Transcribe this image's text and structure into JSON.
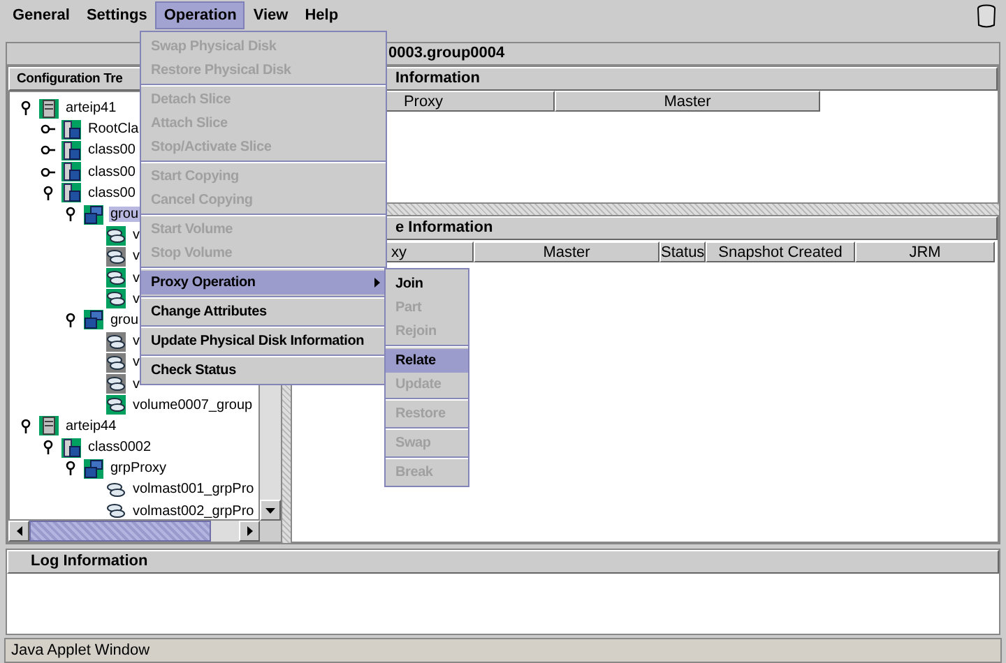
{
  "menubar": [
    {
      "label": "General",
      "selected": false
    },
    {
      "label": "Settings",
      "selected": false
    },
    {
      "label": "Operation",
      "selected": true
    },
    {
      "label": "View",
      "selected": false
    },
    {
      "label": "Help",
      "selected": false
    }
  ],
  "title_bar": "0003.group0004",
  "tree_panel": {
    "title": "Configuration Tre"
  },
  "tree": [
    {
      "label": "arteip41",
      "kind": "host",
      "expanded": true,
      "selected": false,
      "children": [
        {
          "label": "RootCla",
          "kind": "class",
          "expanded": false,
          "selected": false
        },
        {
          "label": "class00",
          "kind": "class",
          "expanded": false,
          "selected": false
        },
        {
          "label": "class00",
          "kind": "class",
          "expanded": false,
          "selected": false
        },
        {
          "label": "class00",
          "kind": "class",
          "expanded": true,
          "selected": false,
          "children": [
            {
              "label": "grou",
              "kind": "group",
              "expanded": true,
              "selected": true,
              "children": [
                {
                  "label": "v",
                  "kind": "volume",
                  "color": "#00a060",
                  "selected": false
                },
                {
                  "label": "v",
                  "kind": "volume",
                  "color": "#808080",
                  "selected": false
                },
                {
                  "label": "v",
                  "kind": "volume",
                  "color": "#00a060",
                  "selected": false
                },
                {
                  "label": "v",
                  "kind": "volume",
                  "color": "#00a060",
                  "selected": false
                }
              ]
            },
            {
              "label": "grou",
              "kind": "group",
              "expanded": true,
              "selected": false,
              "children": [
                {
                  "label": "v",
                  "kind": "volume",
                  "color": "#808080",
                  "selected": false
                },
                {
                  "label": "v",
                  "kind": "volume",
                  "color": "#808080",
                  "selected": false
                },
                {
                  "label": "v",
                  "kind": "volume",
                  "color": "#808080",
                  "selected": false
                },
                {
                  "label": "volume0007_group",
                  "kind": "volume",
                  "color": "#00a060",
                  "selected": false
                }
              ]
            }
          ]
        }
      ]
    },
    {
      "label": "arteip44",
      "kind": "host",
      "expanded": true,
      "selected": false,
      "children": [
        {
          "label": "class0002",
          "kind": "class",
          "expanded": true,
          "selected": false,
          "children": [
            {
              "label": "grpProxy",
              "kind": "group",
              "expanded": true,
              "selected": false,
              "children": [
                {
                  "label": "volmast001_grpPro",
                  "kind": "volume",
                  "selected": false
                },
                {
                  "label": "volmast002_grpPro",
                  "kind": "volume",
                  "selected": false
                }
              ]
            }
          ]
        }
      ]
    }
  ],
  "proxy_panel": {
    "title": "Information",
    "columns": [
      "Proxy",
      "Master"
    ]
  },
  "volume_panel": {
    "title": "e Information",
    "columns": [
      "xy",
      "Master",
      "Status",
      "Snapshot Created",
      "JRM"
    ]
  },
  "log_panel": {
    "title": "Log Information"
  },
  "status_bar": "Java Applet Window",
  "operation_menu": {
    "sections": [
      [
        {
          "label": "Swap Physical Disk",
          "kind": "item",
          "enabled": false,
          "selected": false
        },
        {
          "label": "Restore Physical Disk",
          "kind": "item",
          "enabled": false,
          "selected": false
        }
      ],
      [
        {
          "label": "Detach Slice",
          "kind": "item",
          "enabled": false,
          "selected": false
        },
        {
          "label": "Attach Slice",
          "kind": "item",
          "enabled": false,
          "selected": false
        },
        {
          "label": "Stop/Activate Slice",
          "kind": "item",
          "enabled": false,
          "selected": false
        }
      ],
      [
        {
          "label": "Start Copying",
          "kind": "item",
          "enabled": false,
          "selected": false
        },
        {
          "label": "Cancel Copying",
          "kind": "item",
          "enabled": false,
          "selected": false
        }
      ],
      [
        {
          "label": "Start Volume",
          "kind": "item",
          "enabled": false,
          "selected": false
        },
        {
          "label": "Stop Volume",
          "kind": "item",
          "enabled": false,
          "selected": false
        }
      ],
      [
        {
          "label": "Proxy Operation",
          "kind": "submenu",
          "enabled": true,
          "selected": true
        }
      ],
      [
        {
          "label": "Change Attributes",
          "kind": "item",
          "enabled": true,
          "selected": false
        }
      ],
      [
        {
          "label": "Update Physical Disk Information",
          "kind": "item",
          "enabled": true,
          "selected": false
        }
      ],
      [
        {
          "label": "Check Status",
          "kind": "item",
          "enabled": true,
          "selected": false
        }
      ]
    ]
  },
  "proxy_submenu": {
    "sections": [
      [
        {
          "label": "Join",
          "kind": "item",
          "enabled": true,
          "selected": false
        },
        {
          "label": "Part",
          "kind": "item",
          "enabled": false,
          "selected": false
        },
        {
          "label": "Rejoin",
          "kind": "item",
          "enabled": false,
          "selected": false
        }
      ],
      [
        {
          "label": "Relate",
          "kind": "item",
          "enabled": true,
          "selected": true
        },
        {
          "label": "Update",
          "kind": "item",
          "enabled": false,
          "selected": false
        }
      ],
      [
        {
          "label": "Restore",
          "kind": "item",
          "enabled": false,
          "selected": false
        }
      ],
      [
        {
          "label": "Swap",
          "kind": "item",
          "enabled": false,
          "selected": false
        }
      ],
      [
        {
          "label": "Break",
          "kind": "item",
          "enabled": false,
          "selected": false
        }
      ]
    ]
  }
}
